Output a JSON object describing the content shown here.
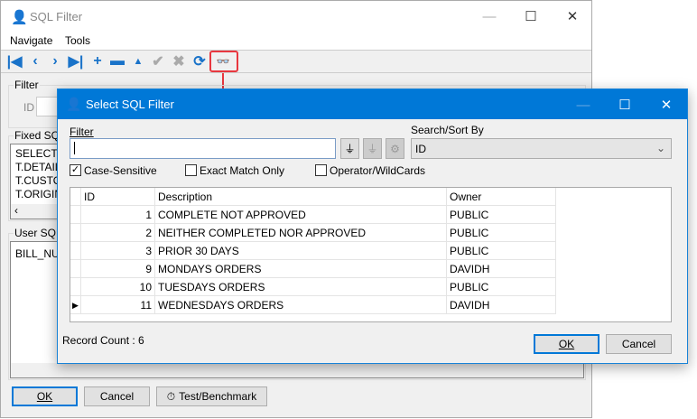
{
  "main_window": {
    "title": "SQL Filter",
    "menu": [
      "Navigate",
      "Tools"
    ],
    "toolbar": [
      "first-icon",
      "prior-icon",
      "next-icon",
      "last-icon",
      "insert-icon",
      "delete-icon",
      "edit-icon",
      "post-icon",
      "cancel-icon",
      "refresh-icon",
      "binoculars-icon"
    ],
    "filter_group": "Filter",
    "id_label": "ID",
    "fixed_sql_group": "Fixed SQL",
    "fixed_sql_lines": [
      "SELECT",
      "T.DETAIL_",
      "T.CUSTOI",
      "T.ORIGIN"
    ],
    "user_sql_group": "User SQL",
    "user_sql_text": "BILL_NUI",
    "ok": "OK",
    "cancel": "Cancel",
    "test": "Test/Benchmark"
  },
  "dialog": {
    "title": "Select SQL Filter",
    "filter_label": "Filter",
    "filter_value": "",
    "search_label": "Search/Sort By",
    "search_value": "ID",
    "checkboxes": [
      {
        "label": "Case-Sensitive",
        "checked": true
      },
      {
        "label": "Exact Match Only",
        "checked": false
      },
      {
        "label": "Operator/WildCards",
        "checked": false
      }
    ],
    "columns": [
      "ID",
      "Description",
      "Owner"
    ],
    "rows": [
      {
        "id": "1",
        "desc": "COMPLETE NOT APPROVED",
        "owner": "PUBLIC"
      },
      {
        "id": "2",
        "desc": "NEITHER COMPLETED NOR APPROVED",
        "owner": "PUBLIC"
      },
      {
        "id": "3",
        "desc": "PRIOR 30 DAYS",
        "owner": "PUBLIC"
      },
      {
        "id": "9",
        "desc": "MONDAYS ORDERS",
        "owner": "DAVIDH"
      },
      {
        "id": "10",
        "desc": "TUESDAYS ORDERS",
        "owner": "PUBLIC"
      },
      {
        "id": "11",
        "desc": "WEDNESDAYS ORDERS",
        "owner": "DAVIDH"
      }
    ],
    "record_count": "Record Count : 6",
    "ok": "OK",
    "cancel": "Cancel"
  },
  "colors": {
    "accent": "#0078d7",
    "highlight": "#e8373f"
  }
}
